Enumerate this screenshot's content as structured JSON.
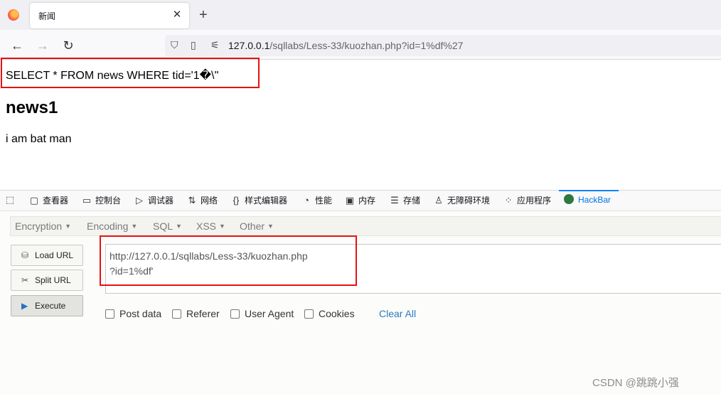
{
  "browser": {
    "tab_title": "新闻",
    "tab_close": "✕",
    "new_tab": "+",
    "url_host": "127.0.0.1",
    "url_path": "/sqllabs/Less-33/kuozhan.php?id=1%df%27"
  },
  "page": {
    "sql": "SELECT * FROM news WHERE tid='1�\\''",
    "heading": "news1",
    "paragraph": "i am bat man"
  },
  "devtools": {
    "tabs": [
      {
        "icon": "inspector-icon",
        "label": "查看器"
      },
      {
        "icon": "console-icon",
        "label": "控制台"
      },
      {
        "icon": "debugger-icon",
        "label": "调试器"
      },
      {
        "icon": "network-icon",
        "label": "网络"
      },
      {
        "icon": "style-editor-icon",
        "label": "样式编辑器"
      },
      {
        "icon": "performance-icon",
        "label": "性能"
      },
      {
        "icon": "memory-icon",
        "label": "内存"
      },
      {
        "icon": "storage-icon",
        "label": "存储"
      },
      {
        "icon": "accessibility-icon",
        "label": "无障碍环境"
      },
      {
        "icon": "application-icon",
        "label": "应用程序"
      },
      {
        "icon": "hackbar-icon",
        "label": "HackBar"
      }
    ],
    "active_color": "#0074e8"
  },
  "hackbar": {
    "menus": [
      "Encoding",
      "Encryption",
      "SQL",
      "XSS",
      "Other"
    ],
    "menu_order": [
      "Encryption",
      "Encoding",
      "SQL",
      "XSS",
      "Other"
    ],
    "buttons": {
      "load": "Load URL",
      "split": "Split URL",
      "execute": "Execute"
    },
    "url_lines": [
      "http://127.0.0.1/sqllabs/Less-33/kuozhan.php",
      "?id=1%df'"
    ],
    "options": {
      "post": "Post data",
      "referer": "Referer",
      "user_agent": "User Agent",
      "cookies": "Cookies"
    },
    "clear_all": "Clear All"
  },
  "watermark": "CSDN @跳跳小强",
  "colors": {
    "highlight_box": "#e81111",
    "link": "#2a7ac0"
  }
}
